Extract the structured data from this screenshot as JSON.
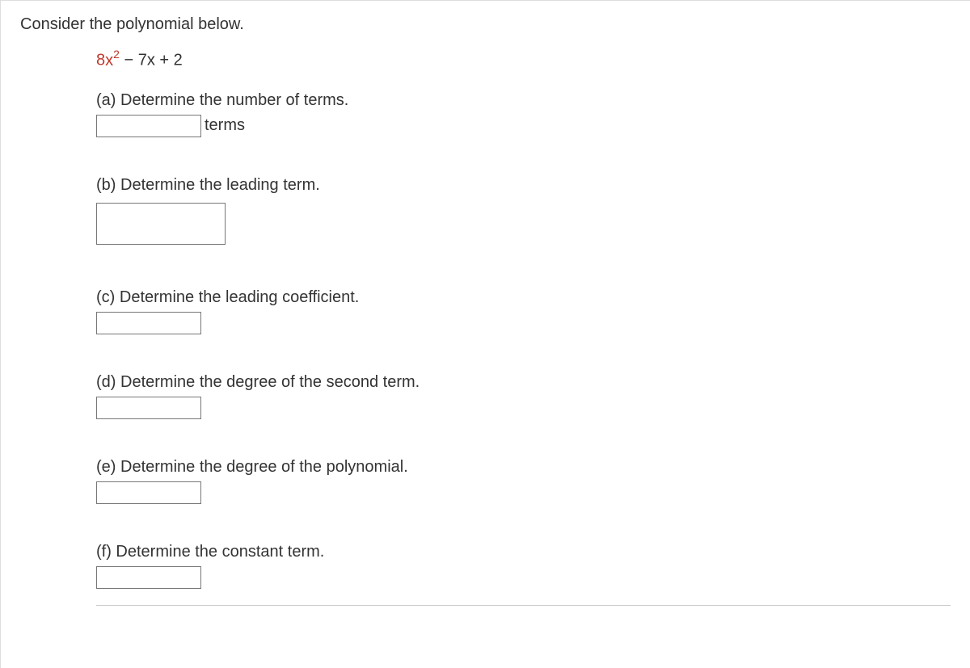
{
  "intro": "Consider the polynomial below.",
  "polynomial": {
    "term1_coef": "8",
    "term1_var": "x",
    "term1_exp": "2",
    "rest": " − 7x + 2"
  },
  "parts": {
    "a": {
      "label": "(a) Determine the number of terms.",
      "suffix": "terms"
    },
    "b": {
      "label": "(b) Determine the leading term."
    },
    "c": {
      "label": "(c) Determine the leading coefficient."
    },
    "d": {
      "label": "(d) Determine the degree of the second term."
    },
    "e": {
      "label": "(e) Determine the degree of the polynomial."
    },
    "f": {
      "label": "(f) Determine the constant term."
    }
  }
}
